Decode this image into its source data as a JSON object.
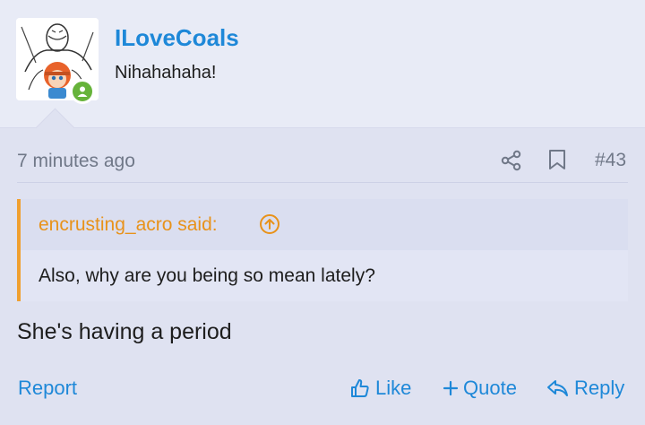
{
  "user": {
    "name": "ILoveCoals",
    "title": "Nihahahaha!"
  },
  "post": {
    "time": "7 minutes ago",
    "number": "#43",
    "message": "She's having a period"
  },
  "quote": {
    "author": "encrusting_acro said:",
    "text": "Also, why are you being so mean lately?"
  },
  "actions": {
    "report": "Report",
    "like": "Like",
    "quote": "Quote",
    "reply": "Reply"
  },
  "colors": {
    "link": "#1e88d8",
    "quote_accent": "#f0a030",
    "online": "#66b33a"
  },
  "icons": [
    "share-icon",
    "bookmark-icon",
    "arrow-up-circle-icon",
    "thumbs-up-icon",
    "plus-icon",
    "reply-icon",
    "online-status-icon"
  ]
}
